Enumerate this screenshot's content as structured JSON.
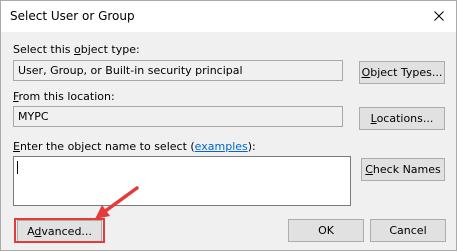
{
  "window": {
    "title": "Select User or Group",
    "close_icon": "close-icon"
  },
  "object_type": {
    "label": "Select this object type:",
    "value": "User, Group, or Built-in security principal",
    "button": "Object Types..."
  },
  "location": {
    "label": "From this location:",
    "value": "MYPC",
    "button": "Locations..."
  },
  "object_name": {
    "label_prefix": "Enter the object name to select (",
    "link": "examples",
    "label_suffix": "):",
    "value": "",
    "check_button": "Check Names"
  },
  "footer": {
    "advanced_button": "Advanced...",
    "ok_button": "OK",
    "cancel_button": "Cancel"
  },
  "annotation": {
    "color": "#e53a3a"
  }
}
